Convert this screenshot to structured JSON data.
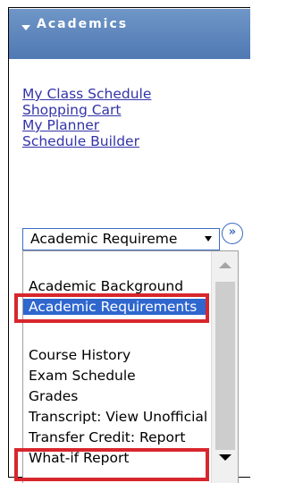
{
  "header": {
    "title": "Academics"
  },
  "links": [
    "My Class Schedule",
    "Shopping Cart",
    "My Planner",
    "Schedule Builder"
  ],
  "dropdown": {
    "selected_value": "Academic Requireme",
    "go_button": "»",
    "options": [
      "Academic Background",
      "Academic Requirements",
      "",
      "Course History",
      "Exam Schedule",
      "Grades",
      "Transcript: View Unofficial",
      "Transfer Credit: Report",
      "What-if Report"
    ],
    "selected_option": "Academic Requirements"
  },
  "colors": {
    "header_bg": "#5a82bb",
    "link": "#3333aa",
    "selection": "#2f67cf",
    "highlight": "#d7262d"
  }
}
